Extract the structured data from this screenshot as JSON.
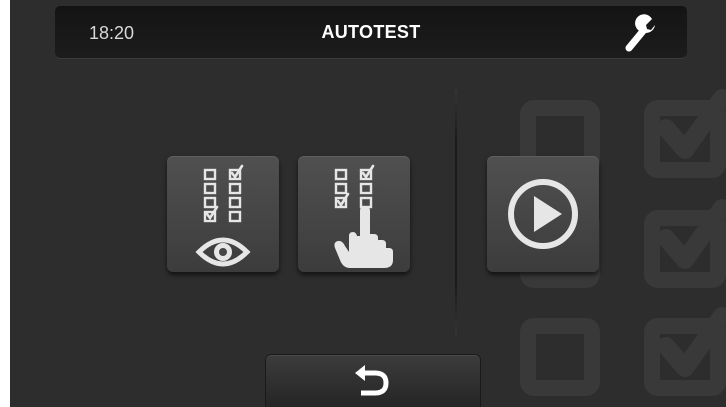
{
  "header": {
    "time": "18:20",
    "title": "AUTOTEST",
    "settings_icon": "wrench-icon"
  },
  "buttons": {
    "view_tests_icon": "checklist-eye-icon",
    "select_tests_icon": "checklist-hand-icon",
    "start_icon": "play-icon",
    "back_icon": "return-arrow-icon"
  },
  "background": {
    "decoration_icon": "checkbox-icons"
  },
  "colors": {
    "screen_bg": "#2d2d2d",
    "header_bg": "#161616",
    "tile_bg": "#474747",
    "icon_fg": "#e6e6e6"
  }
}
